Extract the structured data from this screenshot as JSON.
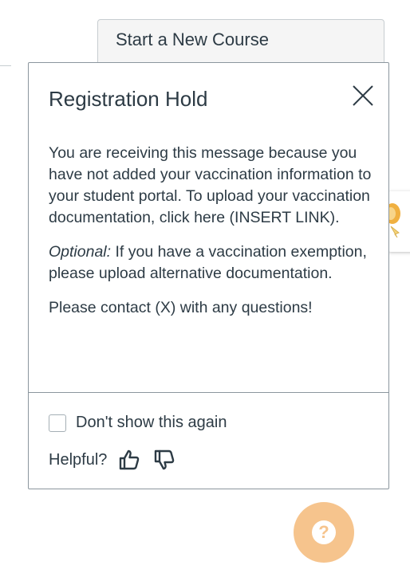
{
  "background": {
    "start_course_label": "Start a New Course"
  },
  "modal": {
    "title": "Registration Hold",
    "body_p1": "You are receiving this message because you have not added your vaccination information to your student portal.  To upload your vaccination documentation, click here (INSERT LINK).",
    "optional_label": "Optional:",
    "body_p2_rest": " If you have a vaccination exemption, please upload alternative documentation.",
    "body_p3": "Please contact (X) with any questions!",
    "dont_show_label": "Don't show this again",
    "helpful_label": "Helpful?"
  },
  "help_fab": {
    "glyph": "?"
  },
  "icons": {
    "close": "close-icon",
    "thumbs_up": "thumbs-up-icon",
    "thumbs_down": "thumbs-down-icon",
    "help": "question-mark-icon"
  },
  "colors": {
    "text": "#2d3b45",
    "border": "#8b969e",
    "help_fab": "#f6c48d"
  }
}
